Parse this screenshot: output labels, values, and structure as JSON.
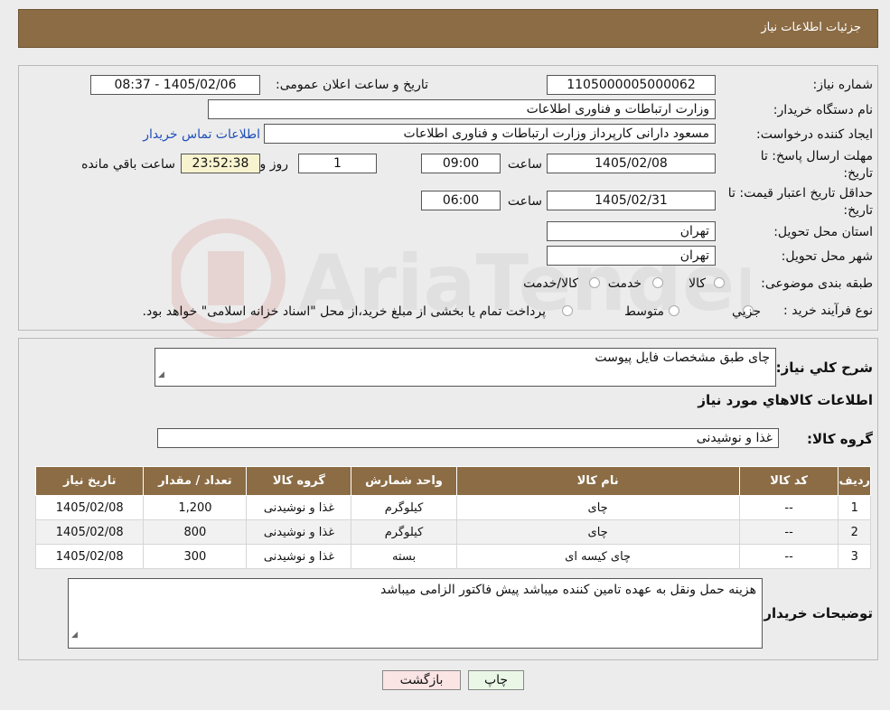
{
  "header": {
    "title": "جزئیات اطلاعات نیاز"
  },
  "form": {
    "need_number_label": "شماره نیاز:",
    "need_number": "1105000005000062",
    "announce_label": "تاریخ و ساعت اعلان عمومی:",
    "announce_value": "1405/02/06 - 08:37",
    "buyer_org_label": "نام دستگاه خریدار:",
    "buyer_org": "وزارت ارتباطات و فناوری اطلاعات",
    "creator_label": "ایجاد کننده درخواست:",
    "creator": "مسعود دارانی کارپرداز وزارت ارتباطات و فناوری اطلاعات",
    "contact_link": "اطلاعات تماس خریدار",
    "deadline_label_1": "مهلت ارسال پاسخ: تا",
    "deadline_label_2": "تاریخ:",
    "deadline_date": "1405/02/08",
    "time_label": "ساعت",
    "deadline_time": "09:00",
    "days_value": "1",
    "days_label": "روز و",
    "remaining_time": "23:52:38",
    "remaining_label": "ساعت باقي مانده",
    "validity_label_1": "حداقل تاریخ اعتبار قیمت: تا",
    "validity_label_2": "تاریخ:",
    "validity_date": "1405/02/31",
    "validity_time": "06:00",
    "province_label": "استان محل تحویل:",
    "province": "تهران",
    "city_label": "شهر محل تحویل:",
    "city": "تهران",
    "category_label": "طبقه بندی موضوعی:",
    "category_options": [
      "کالا",
      "خدمت",
      "کالا/خدمت"
    ],
    "process_label": "نوع فرآیند خرید :",
    "process_options": [
      "جزيي",
      "متوسط"
    ],
    "process_note": "پرداخت تمام یا بخشی از مبلغ خرید،از محل \"اسناد خزانه اسلامی\" خواهد بود."
  },
  "summary": {
    "label": "شرح كلي نياز:",
    "value": "چای طبق مشخصات فایل پیوست",
    "goods_title": "اطلاعات كالاهاي مورد نياز",
    "group_label": "گروه کالا:",
    "group_value": "غذا و نوشیدنی"
  },
  "table": {
    "headers": [
      "رديف",
      "کد کالا",
      "نام کالا",
      "واحد شمارش",
      "گروه کالا",
      "تعداد / مقدار",
      "تاریخ نیاز"
    ],
    "rows": [
      [
        "1",
        "--",
        "چای",
        "کیلوگرم",
        "غذا و نوشیدنی",
        "1,200",
        "1405/02/08"
      ],
      [
        "2",
        "--",
        "چای",
        "کیلوگرم",
        "غذا و نوشیدنی",
        "800",
        "1405/02/08"
      ],
      [
        "3",
        "--",
        "چای کیسه ای",
        "بسته",
        "غذا و نوشیدنی",
        "300",
        "1405/02/08"
      ]
    ]
  },
  "buyer_notes": {
    "label": "توضیحات خریدار:",
    "value": "هزینه حمل ونقل به عهده تامین کننده میباشد پیش فاکتور الزامی میباشد"
  },
  "buttons": {
    "print": "چاپ",
    "back": "بازگشت"
  },
  "watermark": "AriaTender.neT",
  "colors": {
    "header_bg": "#8b6c45",
    "link": "#1f4fb8",
    "print_bg": "#eaf7e6",
    "back_bg": "#fbe4e4"
  }
}
